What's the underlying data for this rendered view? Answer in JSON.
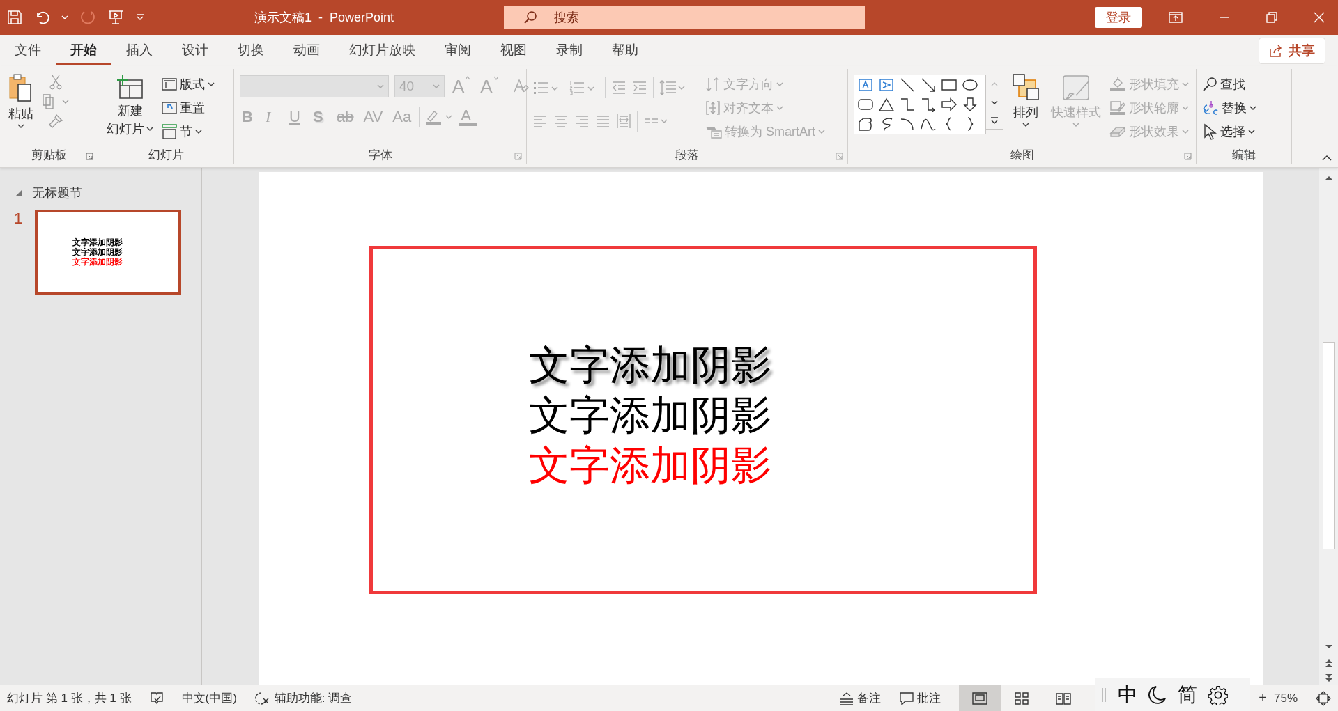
{
  "title_bar": {
    "title": "演示文稿1  -  PowerPoint",
    "search": {
      "placeholder": "搜索"
    },
    "sign_in": "登录"
  },
  "tabs": [
    {
      "label": "文件",
      "selected": false
    },
    {
      "label": "开始",
      "selected": true
    },
    {
      "label": "插入",
      "selected": false
    },
    {
      "label": "设计",
      "selected": false
    },
    {
      "label": "切换",
      "selected": false
    },
    {
      "label": "动画",
      "selected": false
    },
    {
      "label": "幻灯片放映",
      "selected": false
    },
    {
      "label": "审阅",
      "selected": false
    },
    {
      "label": "视图",
      "selected": false
    },
    {
      "label": "录制",
      "selected": false
    },
    {
      "label": "帮助",
      "selected": false
    }
  ],
  "share": "共享",
  "ribbon": {
    "clipboard": {
      "label": "剪贴板",
      "paste": "粘贴"
    },
    "slides": {
      "label": "幻灯片",
      "new_slide": [
        "新建",
        "幻灯片"
      ],
      "buttons": [
        {
          "kind": "layout",
          "label": "版式"
        },
        {
          "kind": "reset",
          "label": "重置"
        },
        {
          "kind": "section",
          "label": "节"
        }
      ]
    },
    "font": {
      "label": "字体",
      "font_size": {
        "value": "40",
        "disabled": true
      },
      "size_buttons": [
        {
          "glyph": "A",
          "kind": "grow"
        },
        {
          "glyph": "A",
          "kind": "shrink"
        }
      ],
      "format_buttons": [
        {
          "glyph": "B",
          "kind": "bold"
        },
        {
          "glyph": "I",
          "kind": "italic"
        },
        {
          "glyph": "U",
          "kind": "underline"
        },
        {
          "glyph": "S",
          "kind": "shadow"
        },
        {
          "glyph": "ab",
          "kind": "strikethrough"
        },
        {
          "glyph": "AV",
          "kind": "spacing"
        },
        {
          "glyph": "Aa",
          "kind": "case"
        }
      ],
      "font_color": "A"
    },
    "paragraph": {
      "label": "段落",
      "buttons": [
        {
          "kind": "direction",
          "label": "文字方向",
          "disabled": true
        },
        {
          "kind": "align",
          "label": "对齐文本",
          "disabled": true
        },
        {
          "kind": "smartart",
          "label": "转换为 SmartArt",
          "disabled": true
        }
      ]
    },
    "drawing": {
      "label": "绘图",
      "arrange": "排列",
      "quick_styles": {
        "label": "快速样式",
        "disabled": true
      },
      "buttons": [
        {
          "kind": "fill",
          "label": "形状填充",
          "disabled": true
        },
        {
          "kind": "outline",
          "label": "形状轮廓",
          "disabled": true
        },
        {
          "kind": "effects",
          "label": "形状效果",
          "disabled": true
        }
      ]
    },
    "editing": {
      "label": "编辑",
      "buttons": [
        {
          "kind": "find",
          "label": "查找"
        },
        {
          "kind": "replace",
          "label": "替换"
        },
        {
          "kind": "select",
          "label": "选择"
        }
      ]
    }
  },
  "slide_panel": {
    "section": "无标题节",
    "expanded": true,
    "slides": [
      {
        "number": "1",
        "selected": true,
        "lines": [
          {
            "text": "文字添加阴影",
            "color": "#000000"
          },
          {
            "text": "文字添加阴影",
            "color": "#000000"
          },
          {
            "text": "文字添加阴影",
            "color": "#ff0000"
          }
        ]
      }
    ]
  },
  "slide": {
    "lines": [
      {
        "text": "文字添加阴影",
        "color": "#000000",
        "shadow": true
      },
      {
        "text": "文字添加阴影",
        "color": "#000000",
        "shadow": false
      },
      {
        "text": "文字添加阴影",
        "color": "#ff0000",
        "shadow": false
      }
    ]
  },
  "status_bar": {
    "slide_info": "幻灯片 第 1 张，共 1 张",
    "language": "中文(中国)",
    "accessibility": "辅助功能: 调查",
    "notes": "备注",
    "comments": "批注",
    "views": [
      {
        "kind": "normal",
        "selected": true
      },
      {
        "kind": "sorter",
        "selected": false
      },
      {
        "kind": "reading",
        "selected": false
      }
    ],
    "zoom_in": "+",
    "zoom": "75%"
  },
  "ime_bar": {
    "mode": "中",
    "script": "简"
  }
}
